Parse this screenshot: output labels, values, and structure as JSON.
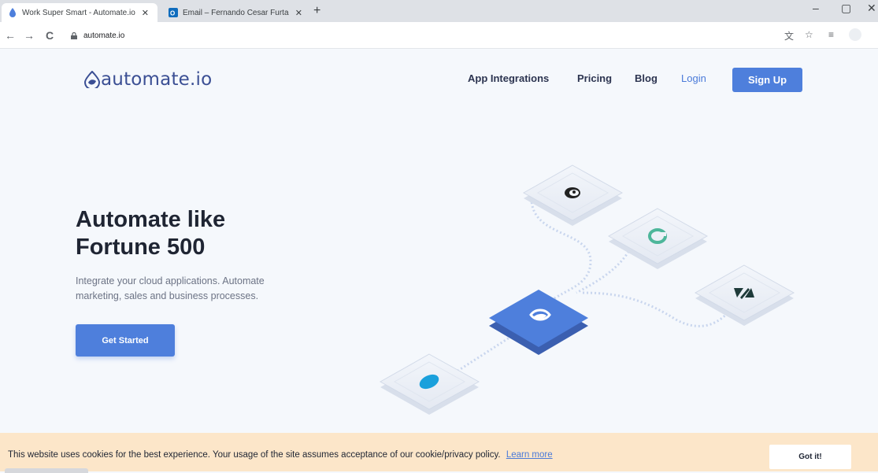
{
  "browser": {
    "tabs": [
      {
        "title": "Work Super Smart - Automate.io",
        "close": "✕"
      },
      {
        "title": "Email – Fernando Cesar Furtado",
        "close": "✕"
      }
    ],
    "new_tab": "+",
    "window_controls": {
      "minimize": "–",
      "maximize": "▢",
      "close": "✕"
    },
    "url": "automate.io",
    "nav": {
      "back": "←",
      "forward": "→",
      "reload": "C"
    },
    "toolbar_icons": [
      "translate-icon",
      "star-icon",
      "reading-list-icon"
    ]
  },
  "header": {
    "logo_text": "automate.io",
    "nav": [
      "App Integrations",
      "Pricing",
      "Blog"
    ],
    "login": "Login",
    "signup": "Sign Up"
  },
  "hero": {
    "headline_line1": "Automate like",
    "headline_line2": "Fortune 500",
    "subtext": "Integrate your cloud applications. Automate marketing, sales and business processes.",
    "cta": "Get Started"
  },
  "illustration": {
    "apps": [
      "mailchimp-icon",
      "copper-icon",
      "zendesk-icon",
      "automate-io-icon",
      "salesforce-icon"
    ],
    "colors": {
      "hub": "#4e7fdc",
      "tile": "#eef2f8"
    }
  },
  "cookie": {
    "text": "This website uses cookies for the best experience. Your usage of the site assumes acceptance of our cookie/privacy policy.",
    "link": "Learn more",
    "button": "Got it!"
  },
  "colors": {
    "accent": "#4e7fdc",
    "cookie_bg": "#fce6c9",
    "text": "#1f2533"
  }
}
